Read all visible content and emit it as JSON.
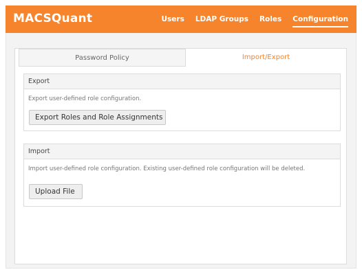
{
  "app": {
    "title": "MACSQuant"
  },
  "nav": {
    "items": [
      {
        "label": "Users"
      },
      {
        "label": "LDAP Groups"
      },
      {
        "label": "Roles"
      },
      {
        "label": "Configuration",
        "active": true
      }
    ]
  },
  "tabs": [
    {
      "label": "Password Policy",
      "active": false
    },
    {
      "label": "Import/Export",
      "active": true
    }
  ],
  "export": {
    "heading": "Export",
    "description": "Export user-defined role configuration.",
    "button_label": "Export Roles and Role Assignments"
  },
  "import": {
    "heading": "Import",
    "description": "Import user-defined role configuration. Existing user-defined role configuration will be deleted.",
    "button_label": "Upload File"
  },
  "colors": {
    "accent": "#f5842c"
  }
}
